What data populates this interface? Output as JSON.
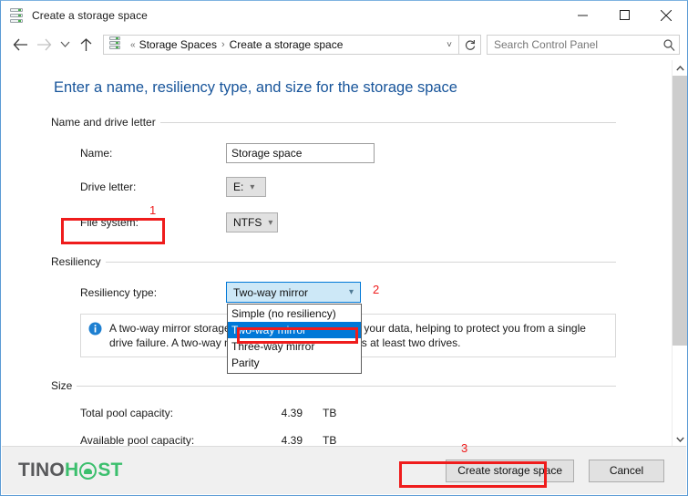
{
  "window": {
    "title": "Create a storage space",
    "title_icon": "storage-drive-icon",
    "minimize_label": "Minimize",
    "maximize_label": "Maximize",
    "close_label": "Close"
  },
  "addressbar": {
    "back_label": "Back",
    "forward_label": "Forward",
    "recent_label": "Recent locations",
    "up_label": "Up one level",
    "breadcrumb_icon": "storage-drive-icon",
    "breadcrumb_chevron": "«",
    "breadcrumb": [
      "Storage Spaces",
      "Create a storage space"
    ],
    "breadcrumb_separator": "›",
    "dropdown_glyph": "˅",
    "refresh_label": "Refresh",
    "search": {
      "placeholder": "Search Control Panel",
      "value": ""
    }
  },
  "main": {
    "heading": "Enter a name, resiliency type, and size for the storage space",
    "name_group": {
      "legend": "Name and drive letter",
      "name_label": "Name:",
      "name_value": "Storage space",
      "name_placeholder": "Storage space",
      "drive_label": "Drive letter:",
      "drive_value": "E:",
      "filesystem_label": "File system:",
      "filesystem_value": "NTFS"
    },
    "resiliency_group": {
      "legend": "Resiliency",
      "type_label": "Resiliency type:",
      "type_value": "Two-way mirror",
      "options": [
        "Simple (no resiliency)",
        "Two-way mirror",
        "Three-way mirror",
        "Parity"
      ],
      "selected_option": "Two-way mirror",
      "info_icon": "information-icon",
      "info_text": "A two-way mirror storage space writes two copies of your data, helping to protect you from a single drive failure. A two-way mirror storage space requires at least two drives."
    },
    "size_group": {
      "legend": "Size",
      "rows": [
        {
          "label": "Total pool capacity:",
          "value": "4.39",
          "unit": "TB"
        },
        {
          "label": "Available pool capacity:",
          "value": "4.39",
          "unit": "TB"
        }
      ]
    }
  },
  "footer": {
    "logo": {
      "part1": "TINO",
      "part2": "H",
      "part3": "ST"
    },
    "create_label": "Create storage space",
    "cancel_label": "Cancel"
  },
  "annotations": {
    "one": "1",
    "two": "2",
    "three": "3"
  },
  "colors": {
    "accent_blue": "#0078d7",
    "heading_blue": "#17549a",
    "annotation_red": "#ef1c1c",
    "logo_green": "#3bbf6d"
  }
}
